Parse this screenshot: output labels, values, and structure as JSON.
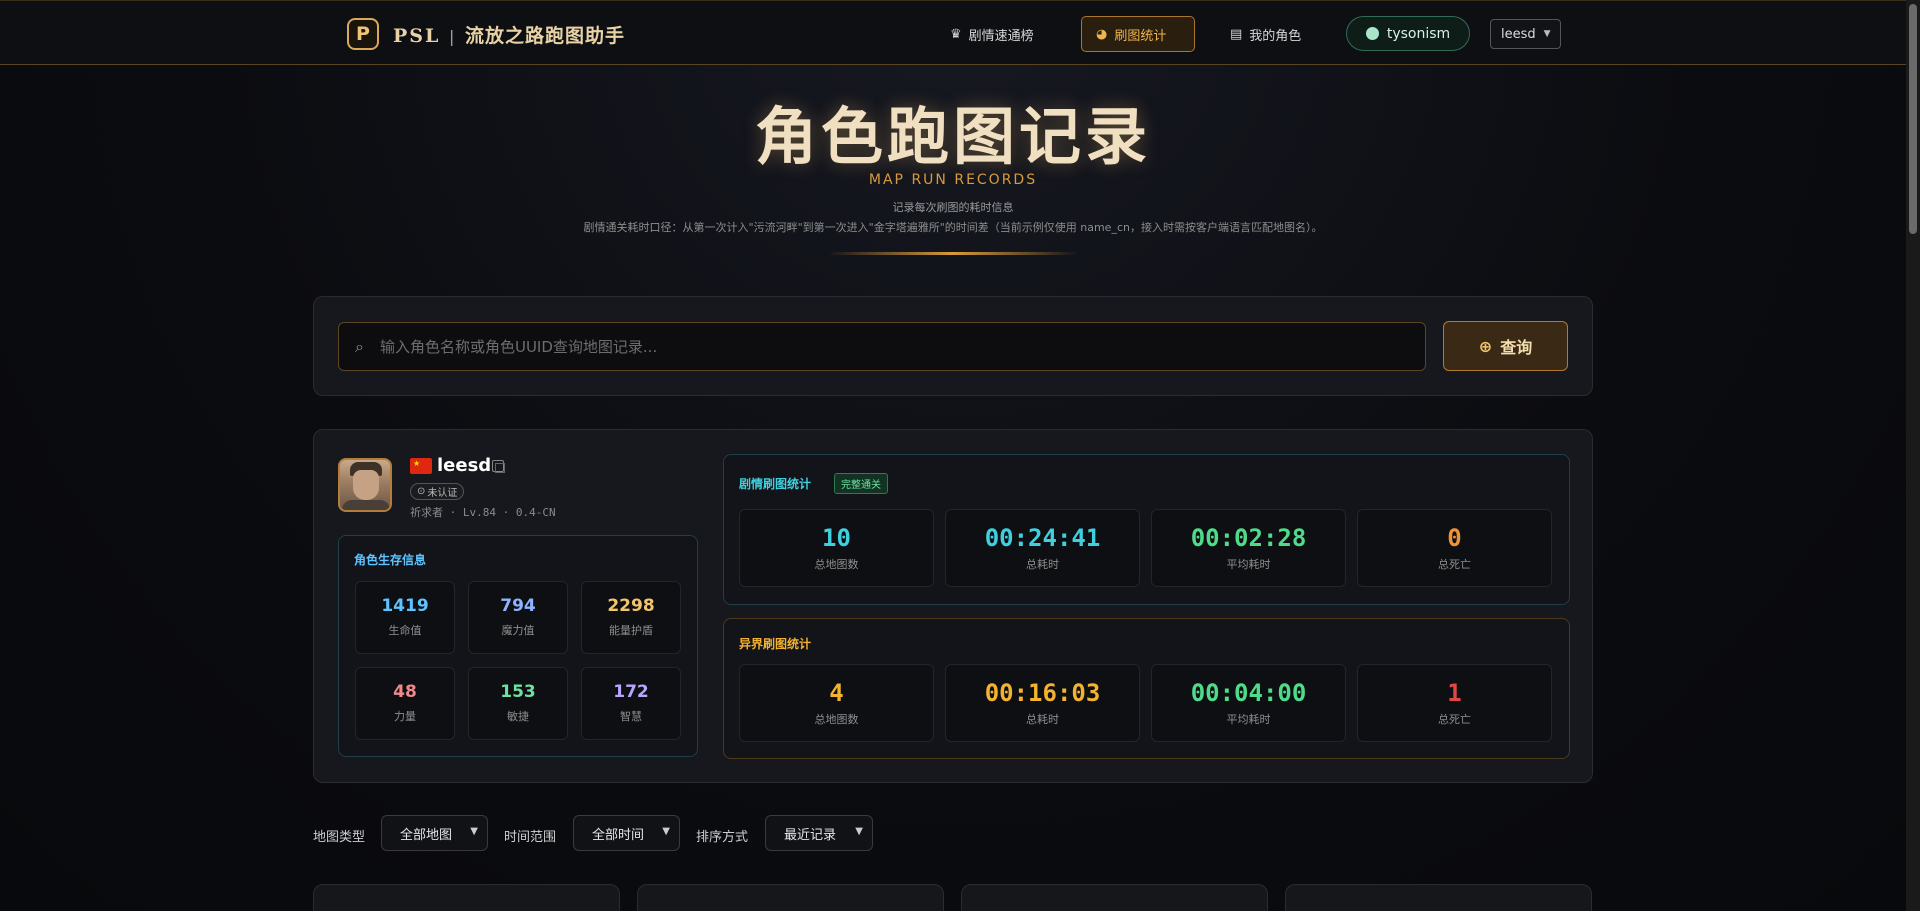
{
  "nav": {
    "logo_letter": "P",
    "brand": "PSL",
    "brand_sep": "|",
    "brand_sub": "流放之路跑图助手",
    "items": [
      {
        "label": "剧情速通榜",
        "icon": "crown-icon"
      },
      {
        "label": "刷图统计",
        "icon": "pie-chart-icon",
        "active": true
      },
      {
        "label": "我的角色",
        "icon": "id-card-icon"
      }
    ],
    "user": "tysonism",
    "character_select": "leesd"
  },
  "hero": {
    "title": "角色跑图记录",
    "subtitle_en": "MAP RUN RECORDS",
    "desc": "记录每次刷图的耗时信息",
    "desc2": "剧情通关耗时口径：从第一次计入\"污流河畔\"到第一次进入\"金字塔遍雅所\"的时间差（当前示例仅使用 name_cn，接入时需按客户端语言匹配地图名）。"
  },
  "search": {
    "placeholder": "输入角色名称或角色UUID查询地图记录...",
    "button": "查询"
  },
  "profile": {
    "name": "leesd",
    "badge": "未认证",
    "meta": "祈求者 · Lv.84 · 0.4-CN",
    "survival": {
      "title": "角色生存信息",
      "stats": [
        {
          "value": "1419",
          "label": "生命值",
          "color": "#5fc3ff"
        },
        {
          "value": "794",
          "label": "魔力值",
          "color": "#8fb4ff"
        },
        {
          "value": "2298",
          "label": "能量护盾",
          "color": "#f3c56a"
        },
        {
          "value": "48",
          "label": "力量",
          "color": "#f08a8a"
        },
        {
          "value": "153",
          "label": "敏捷",
          "color": "#6fe0a1"
        },
        {
          "value": "172",
          "label": "智慧",
          "color": "#b9a6ff"
        }
      ]
    },
    "story": {
      "title": "剧情刷图统计",
      "tag": "完整通关",
      "stats": [
        {
          "value": "10",
          "label": "总地图数",
          "color": "#3fd0e0"
        },
        {
          "value": "00:24:41",
          "label": "总耗时",
          "color": "#3fd0e0"
        },
        {
          "value": "00:02:28",
          "label": "平均耗时",
          "color": "#4fdc8a"
        },
        {
          "value": "0",
          "label": "总死亡",
          "color": "#f0923a"
        }
      ]
    },
    "abyss": {
      "title": "异界刷图统计",
      "stats": [
        {
          "value": "4",
          "label": "总地图数",
          "color": "#f3b230"
        },
        {
          "value": "00:16:03",
          "label": "总耗时",
          "color": "#f3b230"
        },
        {
          "value": "00:04:00",
          "label": "平均耗时",
          "color": "#4fdc8a"
        },
        {
          "value": "1",
          "label": "总死亡",
          "color": "#e04848"
        }
      ]
    }
  },
  "filters": {
    "map_type_label": "地图类型",
    "map_type_value": "全部地图",
    "time_label": "时间范围",
    "time_value": "全部时间",
    "sort_label": "排序方式",
    "sort_value": "最近记录"
  }
}
